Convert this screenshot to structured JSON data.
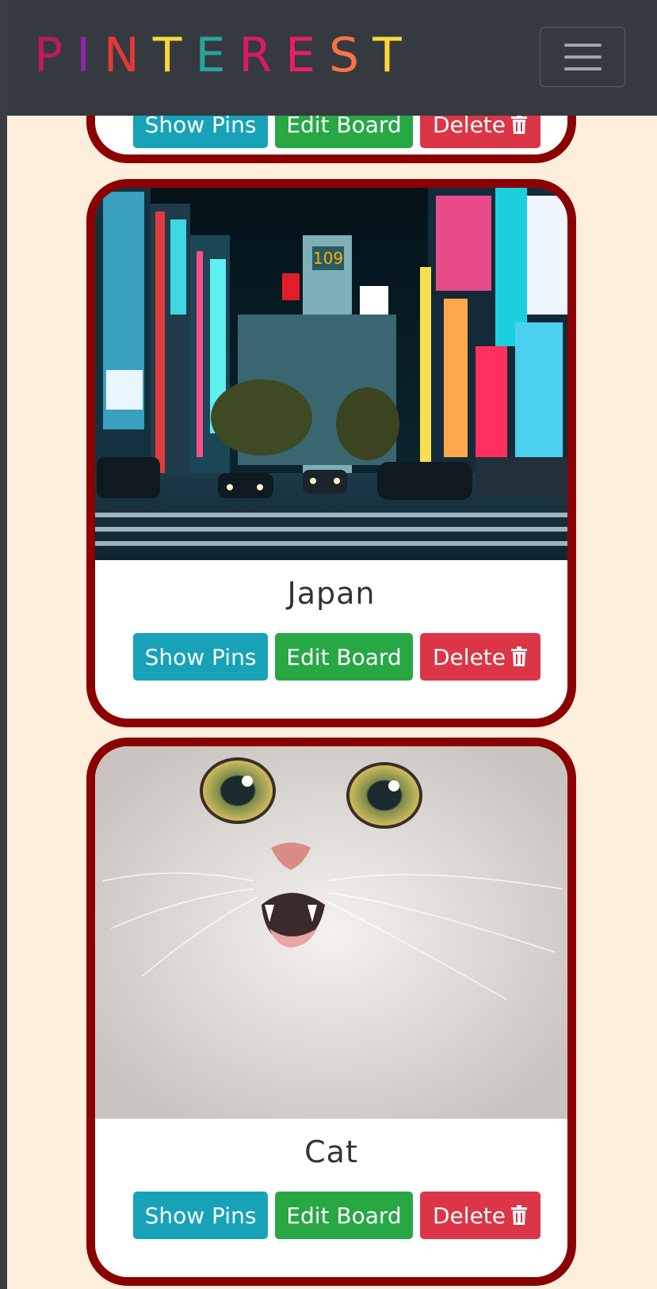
{
  "navbar": {
    "brand_letters": [
      {
        "ch": "P",
        "color": "#c2185b"
      },
      {
        "ch": "I",
        "color": "#8e24aa"
      },
      {
        "ch": "N",
        "color": "#e53935"
      },
      {
        "ch": "T",
        "color": "#fdd835"
      },
      {
        "ch": "E",
        "color": "#26a69a"
      },
      {
        "ch": "R",
        "color": "#d81b60"
      },
      {
        "ch": "E",
        "color": "#e91e63"
      },
      {
        "ch": "S",
        "color": "#ff7043"
      },
      {
        "ch": "T",
        "color": "#fdd835"
      }
    ],
    "toggler_icon": "hamburger-icon"
  },
  "boards": [
    {
      "title": "",
      "show_label": "Show Pins",
      "edit_label": "Edit Board",
      "delete_label": "Delete",
      "delete_icon": "trash-icon"
    },
    {
      "title": "Japan",
      "image": "city-night-street-photo",
      "show_label": "Show Pins",
      "edit_label": "Edit Board",
      "delete_label": "Delete",
      "delete_icon": "trash-icon"
    },
    {
      "title": "Cat",
      "image": "white-cat-photo",
      "show_label": "Show Pins",
      "edit_label": "Edit Board",
      "delete_label": "Delete",
      "delete_icon": "trash-icon"
    }
  ],
  "colors": {
    "page_bg": "#ffeedb",
    "navbar_bg": "#343a40",
    "card_border": "#8b0000",
    "btn_info": "#17a2b8",
    "btn_success": "#28a745",
    "btn_danger": "#dc3545"
  }
}
